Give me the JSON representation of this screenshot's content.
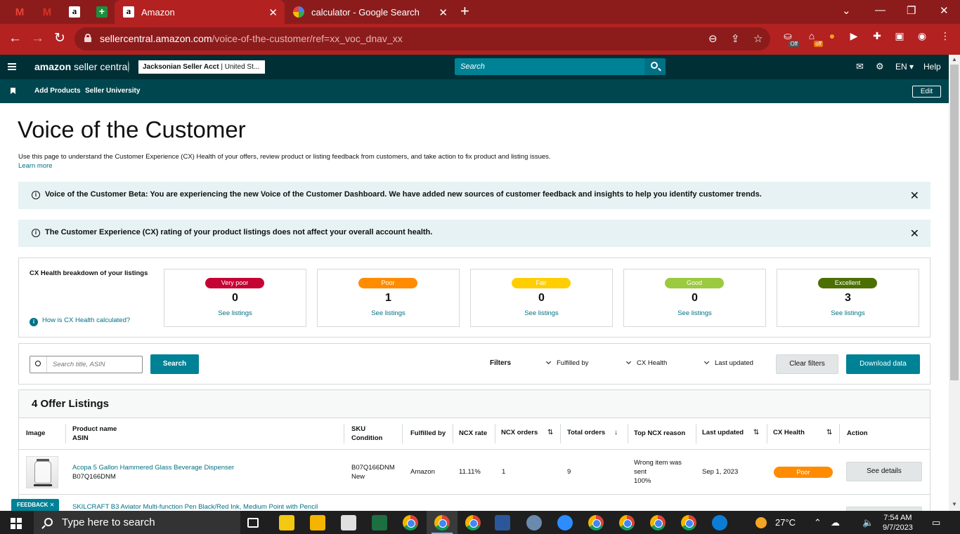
{
  "browser": {
    "tabs": [
      {
        "label": "Amazon",
        "active": true
      },
      {
        "label": "calculator - Google Search",
        "active": false
      }
    ],
    "url_host": "sellercentral.amazon.com",
    "url_path": "/voice-of-the-customer/ref=xx_voc_dnav_xx",
    "extension_badges": [
      "Off",
      "off"
    ]
  },
  "header": {
    "logo_main": "amazon",
    "logo_sub": " seller central",
    "account_name": "Jacksonian Seller Acct",
    "account_region": " | United St...",
    "search_placeholder": "Search",
    "language": "EN",
    "help": "Help"
  },
  "subnav": {
    "links": [
      "Add Products",
      "Seller University"
    ],
    "edit_label": "Edit"
  },
  "page": {
    "title": "Voice of the Customer",
    "description": "Use this page to understand the Customer Experience (CX) Health of your offers, review product or listing feedback from customers, and take action to fix product and listing issues.",
    "learn_more": "Learn more"
  },
  "banners": [
    {
      "text": "Voice of the Customer Beta: You are experiencing the new Voice of the Customer Dashboard. We have added new sources of customer feedback and insights to help you identify customer trends."
    },
    {
      "text": "The Customer Experience (CX) rating of your product listings does not affect your overall account health."
    }
  ],
  "cx_health": {
    "title": "CX Health breakdown of your listings",
    "how_link": "How is CX Health calculated?",
    "see_listings": "See listings",
    "cards": [
      {
        "label": "Very poor",
        "count": "0",
        "color": "#c40233"
      },
      {
        "label": "Poor",
        "count": "1",
        "color": "#ff8c00"
      },
      {
        "label": "Fair",
        "count": "0",
        "color": "#ffce00"
      },
      {
        "label": "Good",
        "count": "0",
        "color": "#9bc93f"
      },
      {
        "label": "Excellent",
        "count": "3",
        "color": "#4b6f00"
      }
    ]
  },
  "filters": {
    "search_placeholder": "Search title, ASIN",
    "search_button": "Search",
    "filters_label": "Filters",
    "dropdowns": [
      "Fulfilled by",
      "CX Health",
      "Last updated"
    ],
    "clear_button": "Clear filters",
    "download_button": "Download data"
  },
  "listings": {
    "title": "4 Offer Listings",
    "columns": {
      "image": "Image",
      "product_name": "Product name",
      "asin": "ASIN",
      "sku": "SKU",
      "condition": "Condition",
      "fulfilled_by": "Fulfilled by",
      "ncx_rate": "NCX rate",
      "ncx_orders": "NCX orders",
      "total_orders": "Total orders",
      "top_ncx_reason": "Top NCX reason",
      "last_updated": "Last updated",
      "cx_health": "CX Health",
      "action": "Action"
    },
    "rows": [
      {
        "product_name": "Acopa 5 Gallon Hammered Glass Beverage Dispenser",
        "asin": "B07Q166DNM",
        "sku": "B07Q166DNM",
        "condition": "New",
        "fulfilled_by": "Amazon",
        "ncx_rate": "11.11%",
        "ncx_orders": "1",
        "total_orders": "9",
        "reason_line1": "Wrong item was",
        "reason_line2": "sent",
        "reason_pct": "100%",
        "last_updated": "Sep 1, 2023",
        "cx_health": "Poor",
        "action": "See details"
      },
      {
        "product_name": "SKILCRAFT B3 Aviator Multi-function Pen Black/Red Ink, Medium Point with Pencil"
      }
    ]
  },
  "feedback": "FEEDBACK",
  "taskbar": {
    "search_text": "Type here to search",
    "weather": "27°C",
    "time": "7:54 AM",
    "date": "9/7/2023"
  }
}
